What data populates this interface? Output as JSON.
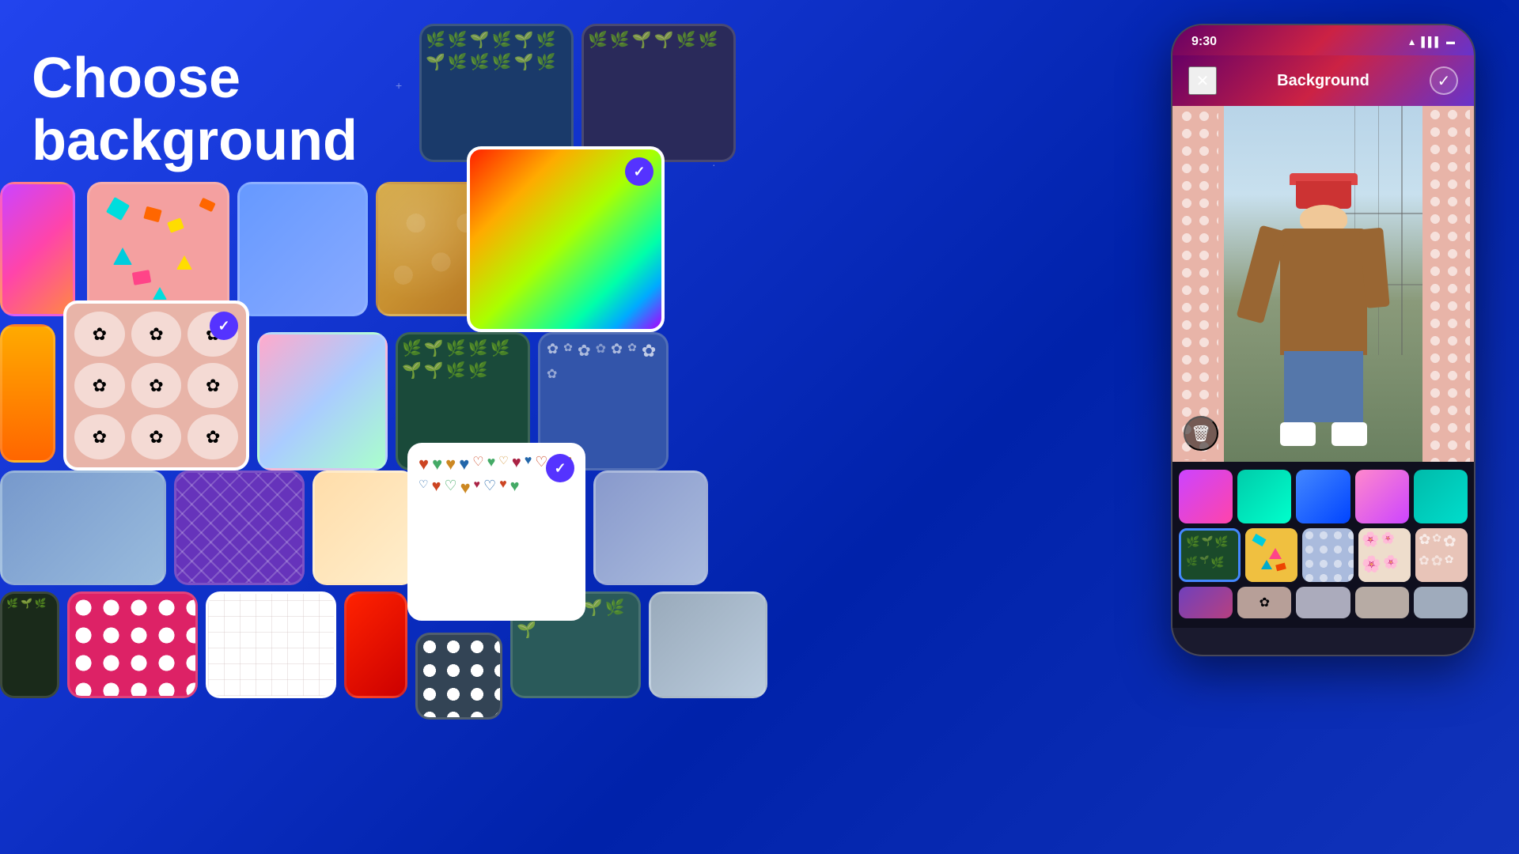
{
  "app": {
    "title": "Choose",
    "subtitle": "background",
    "bg_color": "#0033cc"
  },
  "phone": {
    "status_bar": {
      "time": "9:30",
      "wifi": "▲▼",
      "signal": "▲▲▲",
      "battery": "🔋"
    },
    "header": {
      "title": "Background",
      "close_icon": "✕",
      "confirm_icon": "✓"
    },
    "delete_icon": "🗑",
    "thumbnails_row1": [
      {
        "id": "thumb-purple",
        "type": "purple-gradient",
        "selected": false
      },
      {
        "id": "thumb-teal",
        "type": "teal-gradient",
        "selected": false
      },
      {
        "id": "thumb-blue",
        "type": "blue-gradient",
        "selected": false
      },
      {
        "id": "thumb-pink",
        "type": "pink-gradient",
        "selected": false
      },
      {
        "id": "thumb-teal2",
        "type": "teal-gradient-2",
        "selected": false
      }
    ],
    "thumbnails_row2": [
      {
        "id": "thumb-dark-leaves",
        "type": "dark-leaves",
        "selected": true
      },
      {
        "id": "thumb-confetti",
        "type": "confetti",
        "selected": false
      },
      {
        "id": "thumb-blue-dots",
        "type": "blue-dots",
        "selected": false
      },
      {
        "id": "thumb-floral",
        "type": "floral",
        "selected": false
      },
      {
        "id": "thumb-pink-flowers",
        "type": "pink-flowers",
        "selected": false
      }
    ]
  },
  "tiles": [
    {
      "id": "tile-purple-gradient",
      "type": "gradient",
      "selected": false,
      "label": "purple gradient tile"
    },
    {
      "id": "tile-confetti",
      "type": "pattern",
      "selected": false,
      "label": "confetti pattern tile"
    },
    {
      "id": "tile-blue-solid",
      "type": "solid",
      "selected": false,
      "label": "blue solid tile"
    },
    {
      "id": "tile-gold",
      "type": "textured",
      "selected": false,
      "label": "gold texture tile"
    },
    {
      "id": "tile-rainbow",
      "type": "gradient",
      "selected": true,
      "label": "rainbow gradient tile"
    },
    {
      "id": "tile-dark-floral",
      "type": "pattern",
      "selected": false,
      "label": "dark floral tile"
    },
    {
      "id": "tile-pink-flowers",
      "type": "pattern",
      "selected": true,
      "label": "pink flower pattern tile"
    },
    {
      "id": "tile-pastel",
      "type": "gradient",
      "selected": false,
      "label": "pastel gradient tile"
    },
    {
      "id": "tile-dark-green",
      "type": "pattern",
      "selected": false,
      "label": "dark green floral tile"
    },
    {
      "id": "tile-blue-flowers",
      "type": "pattern",
      "selected": false,
      "label": "blue flower tile"
    },
    {
      "id": "tile-hearts",
      "type": "pattern",
      "selected": true,
      "label": "hearts pattern tile"
    },
    {
      "id": "tile-purple-diamond",
      "type": "pattern",
      "selected": false,
      "label": "purple diamond tile"
    },
    {
      "id": "tile-pink-dots",
      "type": "pattern",
      "selected": false,
      "label": "pink dots tile"
    },
    {
      "id": "tile-lace",
      "type": "pattern",
      "selected": false,
      "label": "lace tile"
    },
    {
      "id": "tile-teal-leaves",
      "type": "pattern",
      "selected": false,
      "label": "teal leaves tile"
    }
  ],
  "buttons": {
    "close_label": "✕",
    "confirm_label": "✓",
    "delete_label": "🗑"
  }
}
